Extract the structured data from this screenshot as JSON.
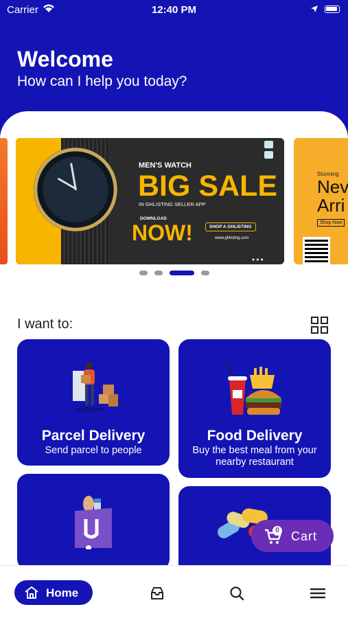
{
  "status_bar": {
    "carrier": "Carrier",
    "time": "12:40 PM"
  },
  "header": {
    "title": "Welcome",
    "subtitle": "How can I help you today?"
  },
  "banner": {
    "small": "MEN'S WATCH",
    "big": "BIG SALE",
    "mid": "IN GHLISTING SELLER APP",
    "download": "DOWNLOAD",
    "now": "NOW!",
    "shop": "SHOP A GHLISTING",
    "url": "www.ghlisting.com"
  },
  "banner_next": {
    "small": "Stunning",
    "big1": "Nev",
    "big2": "Arri",
    "shop": "Shop Now"
  },
  "carousel": {
    "active_index": 2,
    "count": 4
  },
  "section": {
    "title": "I want to:"
  },
  "cards": [
    {
      "title": "Parcel Delivery",
      "desc": "Send parcel to people"
    },
    {
      "title": "Food Delivery",
      "desc1": "Buy the best meal from your",
      "desc2": "nearby restaurant"
    }
  ],
  "cart": {
    "label": "Cart",
    "count": "0"
  },
  "nav": {
    "home_label": "Home"
  },
  "colors": {
    "primary": "#1414b4",
    "cart": "#6b2db5",
    "banner_yellow": "#f7b500"
  }
}
